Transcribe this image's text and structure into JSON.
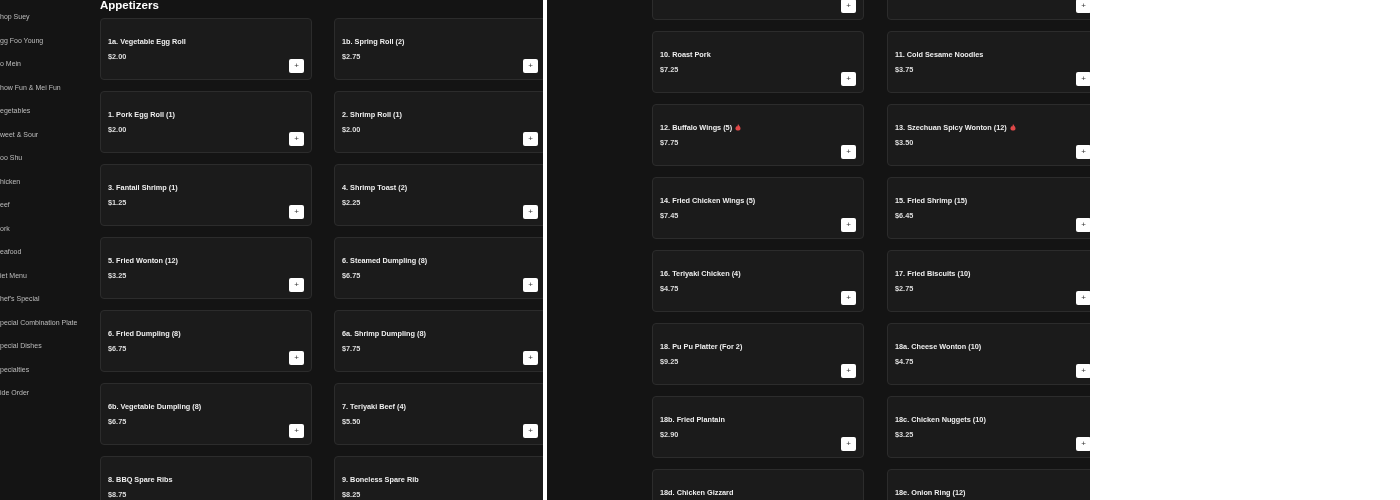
{
  "left_panel": {
    "sidebar": {
      "items": [
        {
          "label": "hop Suey"
        },
        {
          "label": "gg Foo Young"
        },
        {
          "label": "o Mein"
        },
        {
          "label": "how Fun & Mei Fun"
        },
        {
          "label": "egetables"
        },
        {
          "label": "weet & Sour"
        },
        {
          "label": "oo Shu"
        },
        {
          "label": "hicken"
        },
        {
          "label": "eef"
        },
        {
          "label": "ork"
        },
        {
          "label": "eafood"
        },
        {
          "label": "iet Menu"
        },
        {
          "label": "hef's Special"
        },
        {
          "label": "pecial Combination Plate"
        },
        {
          "label": "pecial Dishes"
        },
        {
          "label": "pecialties"
        },
        {
          "label": "ide Order"
        }
      ]
    },
    "heading": "Appetizers",
    "items": [
      {
        "name": "1a. Vegetable Egg Roll",
        "price": "$2.00",
        "add": "+",
        "spicy": false
      },
      {
        "name": "1b. Spring Roll (2)",
        "price": "$2.75",
        "add": "+",
        "spicy": false
      },
      {
        "name": "1. Pork Egg Roll (1)",
        "price": "$2.00",
        "add": "+",
        "spicy": false
      },
      {
        "name": "2. Shrimp Roll (1)",
        "price": "$2.00",
        "add": "+",
        "spicy": false
      },
      {
        "name": "3. Fantail Shrimp (1)",
        "price": "$1.25",
        "add": "+",
        "spicy": false
      },
      {
        "name": "4. Shrimp Toast (2)",
        "price": "$2.25",
        "add": "+",
        "spicy": false
      },
      {
        "name": "5. Fried Wonton (12)",
        "price": "$3.25",
        "add": "+",
        "spicy": false
      },
      {
        "name": "6. Steamed Dumpling (8)",
        "price": "$6.75",
        "add": "+",
        "spicy": false
      },
      {
        "name": "6. Fried Dumpling (8)",
        "price": "$6.75",
        "add": "+",
        "spicy": false
      },
      {
        "name": "6a. Shrimp Dumpling (8)",
        "price": "$7.75",
        "add": "+",
        "spicy": false
      },
      {
        "name": "6b. Vegetable Dumpling (8)",
        "price": "$6.75",
        "add": "+",
        "spicy": false
      },
      {
        "name": "7. Teriyaki Beef (4)",
        "price": "$5.50",
        "add": "+",
        "spicy": false
      },
      {
        "name": "8. BBQ Spare Ribs",
        "price": "$8.75",
        "spicy": false
      },
      {
        "name": "9. Boneless Spare Rib",
        "price": "$8.25",
        "spicy": false
      }
    ]
  },
  "right_panel": {
    "items": [
      {
        "add": "+"
      },
      {
        "add": "+"
      },
      {
        "name": "10. Roast Pork",
        "price": "$7.25",
        "add": "+",
        "spicy": false
      },
      {
        "name": "11. Cold Sesame Noodles",
        "price": "$3.75",
        "add": "+",
        "spicy": false
      },
      {
        "name": "12. Buffalo Wings (5)",
        "price": "$7.75",
        "add": "+",
        "spicy": true
      },
      {
        "name": "13. Szechuan Spicy Wonton (12)",
        "price": "$3.50",
        "add": "+",
        "spicy": true
      },
      {
        "name": "14. Fried Chicken Wings (5)",
        "price": "$7.45",
        "add": "+",
        "spicy": false
      },
      {
        "name": "15. Fried Shrimp (15)",
        "price": "$6.45",
        "add": "+",
        "spicy": false
      },
      {
        "name": "16. Teriyaki Chicken (4)",
        "price": "$4.75",
        "add": "+",
        "spicy": false
      },
      {
        "name": "17. Fried Biscuits (10)",
        "price": "$2.75",
        "add": "+",
        "spicy": false
      },
      {
        "name": "18. Pu Pu Platter (For 2)",
        "price": "$9.25",
        "add": "+",
        "spicy": false
      },
      {
        "name": "18a. Cheese Wonton (10)",
        "price": "$4.75",
        "add": "+",
        "spicy": false
      },
      {
        "name": "18b. Fried Plantain",
        "price": "$2.90",
        "add": "+",
        "spicy": false
      },
      {
        "name": "18c. Chicken Nuggets (10)",
        "price": "$3.25",
        "add": "+",
        "spicy": false
      },
      {
        "name": "18d. Chicken Gizzard",
        "spicy": false
      },
      {
        "name": "18e. Onion Ring (12)",
        "spicy": false
      }
    ]
  }
}
